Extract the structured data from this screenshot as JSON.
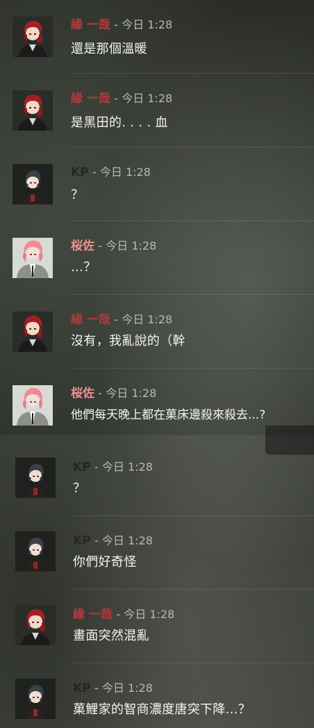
{
  "messages": [
    {
      "author": "緣 一哉",
      "time": "- 今日 1:28",
      "text": "還是那個溫暖",
      "avatar": "red-hair-character-avatar"
    },
    {
      "author": "緣 一哉",
      "time": "- 今日 1:28",
      "text": "是黑田的. . . .  血",
      "avatar": "red-hair-character-avatar"
    },
    {
      "author": "KP",
      "time": "- 今日 1:28",
      "text": "？",
      "avatar": "dark-hair-character-avatar"
    },
    {
      "author": "桜佐",
      "time": "- 今日 1:28",
      "text": "...？",
      "avatar": "pink-hair-character-avatar"
    },
    {
      "author": "緣 一哉",
      "time": "- 今日 1:28",
      "text": "沒有，我亂說的（幹",
      "avatar": "red-hair-character-avatar"
    },
    {
      "author": "桜佐",
      "time": "- 今日 1:28",
      "text": "他們每天晚上都在菓床邊殺來殺去...?",
      "avatar": "pink-hair-character-avatar"
    },
    {
      "author": "KP",
      "time": "- 今日 1:28",
      "text": "？",
      "avatar": "dark-hair-character-avatar"
    },
    {
      "author": "KP",
      "time": "- 今日 1:28",
      "text": "你們好奇怪",
      "avatar": "dark-hair-character-avatar"
    },
    {
      "author": "緣 一哉",
      "time": "- 今日 1:28",
      "text": "畫面突然混亂",
      "avatar": "red-hair-character-avatar"
    },
    {
      "author": "KP",
      "time": "- 今日 1:28",
      "text": "菓鯉家的智商濃度唐突下降...？",
      "avatar": "dark-hair-character-avatar"
    }
  ],
  "colors": {
    "yuan": "#b03a3e",
    "kp": "#262626",
    "sakura": "#ef8e90",
    "timestamp": "#b7b9b5",
    "message": "#f4f4f2"
  }
}
